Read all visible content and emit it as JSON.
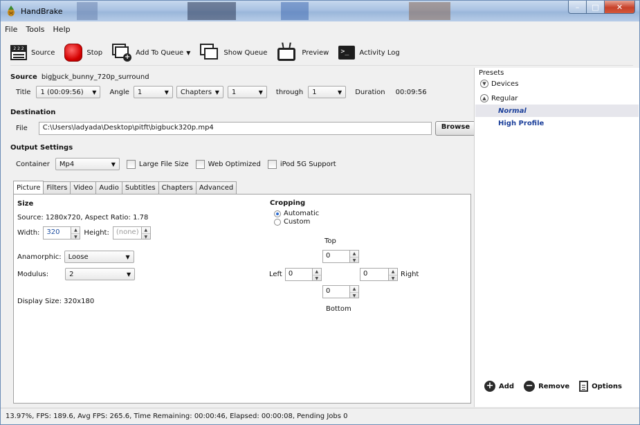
{
  "window": {
    "title": "HandBrake"
  },
  "menu": [
    "File",
    "Tools",
    "Help"
  ],
  "toolbar": {
    "source": "Source",
    "stop": "Stop",
    "add_to_queue": "Add To Queue",
    "show_queue": "Show Queue",
    "preview": "Preview",
    "activity_log": "Activity Log"
  },
  "source": {
    "label": "Source",
    "name_prefix": "big",
    "name_underlined": "b",
    "name_suffix": "uck_bunny_720p_surround",
    "title_label": "Title",
    "title_value": "1 (00:09:56)",
    "angle_label": "Angle",
    "angle_value": "1",
    "range_mode": "Chapters",
    "range_start": "1",
    "through_label": "through",
    "range_end": "1",
    "duration_label": "Duration",
    "duration_value": "00:09:56"
  },
  "destination": {
    "label": "Destination",
    "file_label": "File",
    "file_value": "C:\\Users\\ladyada\\Desktop\\pitft\\bigbuck320p.mp4",
    "browse": "Browse"
  },
  "output": {
    "label": "Output Settings",
    "container_label": "Container",
    "container_value": "Mp4",
    "large_file": "Large File Size",
    "web_optimized": "Web Optimized",
    "ipod": "iPod 5G Support"
  },
  "tabs": [
    "Picture",
    "Filters",
    "Video",
    "Audio",
    "Subtitles",
    "Chapters",
    "Advanced"
  ],
  "picture": {
    "size_heading": "Size",
    "source_info": "Source:  1280x720, Aspect Ratio: 1.78",
    "width_label": "Width:",
    "width_value": "320",
    "height_label": "Height:",
    "height_placeholder": "(none)",
    "anamorphic_label": "Anamorphic:",
    "anamorphic_value": "Loose",
    "modulus_label": "Modulus:",
    "modulus_value": "2",
    "display_size": "Display Size:  320x180",
    "cropping_heading": "Cropping",
    "crop_automatic": "Automatic",
    "crop_custom": "Custom",
    "top_label": "Top",
    "top_value": "0",
    "left_label": "Left",
    "left_value": "0",
    "right_value": "0",
    "right_label": "Right",
    "bottom_value": "0",
    "bottom_label": "Bottom"
  },
  "presets": {
    "heading": "Presets",
    "groups": [
      {
        "name": "Devices",
        "state": "collapsed"
      },
      {
        "name": "Regular",
        "state": "expanded"
      }
    ],
    "items": [
      "Normal",
      "High Profile"
    ],
    "selected": "Normal",
    "add": "Add",
    "remove": "Remove",
    "options": "Options"
  },
  "status": "13.97%,  FPS: 189.6,  Avg FPS: 265.6,  Time Remaining: 00:00:46,  Elapsed: 00:00:08,  Pending Jobs 0",
  "colors": {
    "selected_preset_bg": "#e6e6ec",
    "preset_link": "#1b3f9a",
    "titlebar": "#a9c2e2"
  }
}
